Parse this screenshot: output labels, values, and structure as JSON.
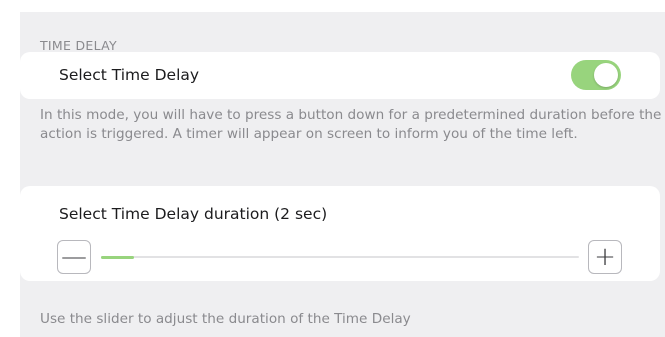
{
  "section": {
    "header": "TIME DELAY"
  },
  "toggle_row": {
    "label": "Select Time Delay",
    "enabled": true
  },
  "description": "In this mode, you will have to press a button down for a predetermined duration before the action is triggered. A timer will appear on screen to inform you of the time left.",
  "duration_row": {
    "label": "Select Time Delay duration (2 sec)",
    "minus_symbol": "—",
    "plus_symbol": "+",
    "slider_fraction": 0.07
  },
  "footer_note": "Use the slider to adjust the duration of the Time Delay",
  "colors": {
    "accent_green": "#98d47d",
    "background": "#efeff1",
    "card": "#ffffff",
    "secondary_text": "#8a8a8e"
  }
}
